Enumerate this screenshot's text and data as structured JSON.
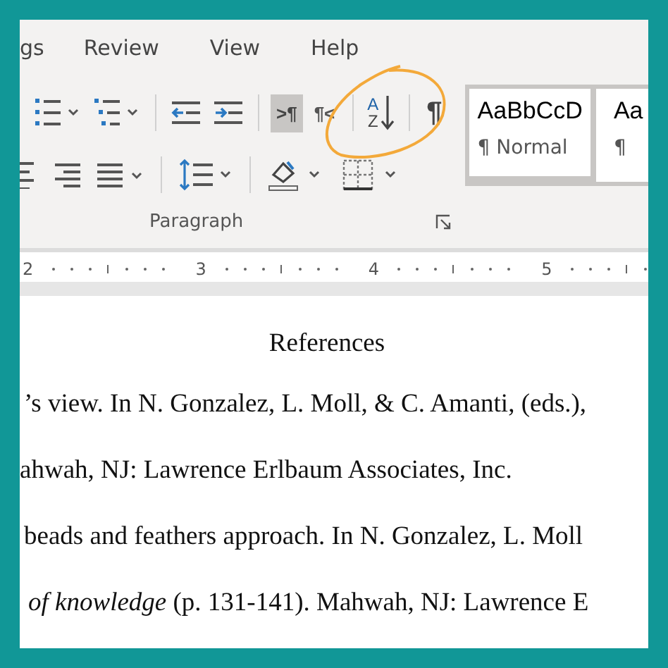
{
  "tabs": [
    {
      "label": "gs"
    },
    {
      "label": "Review"
    },
    {
      "label": "View"
    },
    {
      "label": "Help"
    }
  ],
  "paragraph_group": {
    "label": "Paragraph",
    "text_direction": [
      {
        "glyph": ">¶",
        "selected": true
      },
      {
        "glyph": "¶<",
        "selected": false
      }
    ],
    "sort": {
      "top": "A",
      "bottom": "Z"
    },
    "show_marks": "¶"
  },
  "styles": [
    {
      "sample": "AaBbCcD",
      "name": "¶ Normal",
      "selected": true
    },
    {
      "sample": "Aa",
      "name": "¶",
      "selected": false
    }
  ],
  "ruler": [
    "2",
    "3",
    "4",
    "5"
  ],
  "document": {
    "heading": "References",
    "lines": [
      "’s view. In N. Gonzalez, L. Moll, & C. Amanti, (eds.),",
      "ahwah, NJ: Lawrence Erlbaum Associates, Inc.",
      "beads and feathers approach. In N. Gonzalez, L. Moll",
      "*of knowledge* (p. 131-141). Mahwah, NJ: Lawrence E"
    ]
  }
}
